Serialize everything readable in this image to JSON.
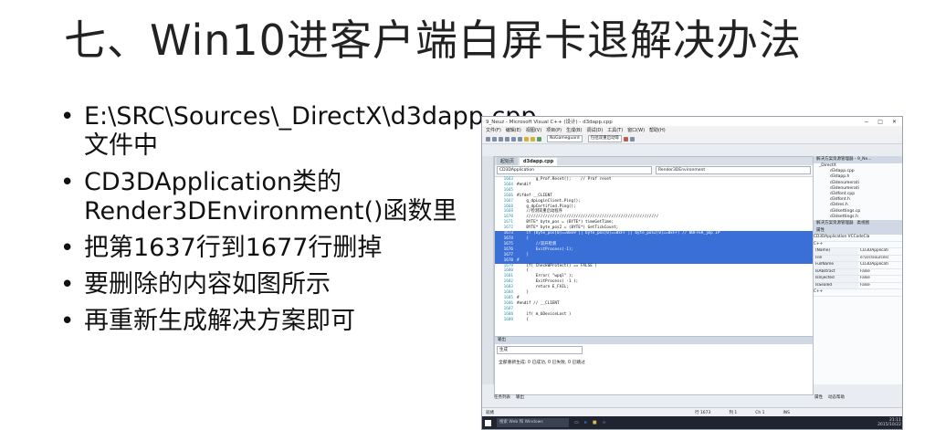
{
  "slide": {
    "title": "七、Win10进客户端白屏卡退解决办法",
    "bullets": [
      "E:\\SRC\\Sources\\_DirectX\\d3dapp.cpp文件中",
      "CD3DApplication类的Render3DEnvironment()函数里",
      "把第1637行到1677行删掉",
      "要删除的内容如图所示",
      "再重新生成解决方案即可"
    ]
  },
  "vs": {
    "window_title": "9_Neuz - Microsoft Visual C++ (设计) - d3dapp.cpp",
    "menu": [
      "文件(F)",
      "编辑(E)",
      "视图(V)",
      "项目(P)",
      "生成(B)",
      "调试(D)",
      "工具(T)",
      "窗口(W)",
      "帮助(H)"
    ],
    "toolbar_config": "NoGameguard",
    "toolbar_find": "包括双重启动等",
    "tabs": [
      "起始页",
      "d3dapp.cpp"
    ],
    "class_combo": "CD3DApplication",
    "method_combo": "Render3DEnvironment",
    "code_lines": [
      {
        "n": "1663",
        "t": "        g_Prof.Reset();    // Prof reset"
      },
      {
        "n": "1664",
        "t": "#endif"
      },
      {
        "n": "1665",
        "t": ""
      },
      {
        "n": "1666",
        "t": "#ifdef __CLIENT"
      },
      {
        "n": "1667",
        "t": "    g_dpLoginClient.Ping();"
      },
      {
        "n": "1668",
        "t": "    g_dpCertified.Ping();"
      },
      {
        "n": "1669",
        "t": "    //检测双重启动程序"
      },
      {
        "n": "1670",
        "t": "    ////////////////////////////////////////////////////////"
      },
      {
        "n": "1671",
        "t": "    BYTE* byte_pos = (BYTE*) timeGetTime;"
      },
      {
        "n": "1672",
        "t": "    BYTE* byte_pos2 = (BYTE*) GetTickCount;"
      },
      {
        "n": "1673",
        "t": "    if (byte_pos[0]==0xE9 || byte_pos[0]==0xFF || byte_pos2[0]==0xFF) // BUFFER_jmp IP"
      },
      {
        "n": "1674",
        "t": "    {"
      },
      {
        "n": "1675",
        "t": "        //双开检测"
      },
      {
        "n": "1676",
        "t": "        ExitProcess(-1);"
      },
      {
        "n": "1677",
        "t": "    }"
      },
      {
        "n": "1678",
        "t": "#"
      },
      {
        "n": "1679",
        "t": "    if( CheckWProtect() == FALSE )"
      },
      {
        "n": "1680",
        "t": "    {"
      },
      {
        "n": "1681",
        "t": "        Error( \"wpql\" );"
      },
      {
        "n": "1682",
        "t": "        ExitProcess( -1 );"
      },
      {
        "n": "1683",
        "t": "        return E_FAIL;"
      },
      {
        "n": "1684",
        "t": "    }"
      },
      {
        "n": "1685",
        "t": "#"
      },
      {
        "n": "1686",
        "t": "#endif // __CLIENT"
      },
      {
        "n": "1687",
        "t": ""
      },
      {
        "n": "1688",
        "t": "    if( m_bDeviceLost )"
      },
      {
        "n": "1689",
        "t": "    {"
      }
    ],
    "selected_from": 10,
    "selected_to": 15,
    "solution_panel_title": "解决方案资源管理器 - 9_Ne...",
    "solution_tree_root": "_DirectX",
    "solution_files": [
      "d3dapp.cpp",
      "d3dapp.h",
      "d3denumerati",
      "d3denumerati",
      "d3dfont.cpp",
      "d3dfont.h",
      "d3dres.h",
      "d3dsettings.cp",
      "d3dsettings.h"
    ],
    "right_tabs": [
      "解决方案资源管理器",
      "类视图"
    ],
    "props_title": "属性",
    "props_object": "CD3DApplication  VCCodeCla",
    "props_section": "C++",
    "props_rows": [
      [
        "(Name)",
        "CD3DApplicati"
      ],
      [
        "File",
        "e:\\src\\sources\\"
      ],
      [
        "FullName",
        "CD3DApplicati"
      ],
      [
        "IsAbstract",
        "False"
      ],
      [
        "IsInjected",
        "False"
      ],
      [
        "IsSealed",
        "False"
      ]
    ],
    "props_footer": "C++",
    "output_title": "输出",
    "output_label": "生成",
    "output_text": "全部重新生成: 0 已成功, 0 已失败, 0 已跳过",
    "bottom_tabs": [
      "任务列表",
      "输出"
    ],
    "right_bottom_tabs": [
      "属性",
      "动态帮助"
    ],
    "status": {
      "left": "就绪",
      "line": "行 1673",
      "col": "列 1",
      "ch": "Ch 1",
      "ins": "INS"
    },
    "taskbar_search": "搜索 Web 和 Windows",
    "clock_time": "21:11",
    "clock_date": "2015/10/22"
  }
}
